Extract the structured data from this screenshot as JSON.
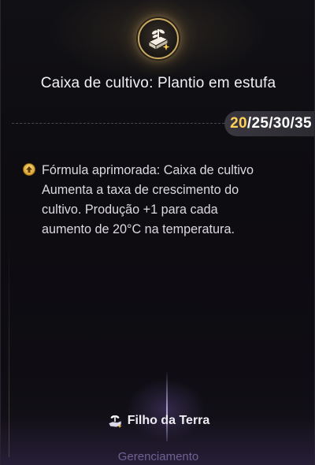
{
  "card": {
    "icon": "greenhouse-plant-icon",
    "title": "Caixa de cultivo: Plantio em estufa",
    "levels": {
      "values": [
        "20",
        "25",
        "30",
        "35"
      ],
      "highlighted_index": 0,
      "separator": "/"
    },
    "description": {
      "icon": "upgrade-arrow-icon",
      "lines": [
        "Fórmula aprimorada: Caixa de cultivo",
        "Aumenta a taxa de crescimento do",
        "cultivo. Produção +1 para cada",
        "aumento de 20°C na temperatura."
      ]
    },
    "faction": {
      "icon": "faction-hand-plant-icon",
      "name": "Filho da Terra"
    },
    "footer": {
      "label": "Gerenciamento"
    }
  },
  "colors": {
    "accent_gold": "#ffd257",
    "emblem_border": "#c9a861",
    "footer_text": "#8d80b6"
  }
}
